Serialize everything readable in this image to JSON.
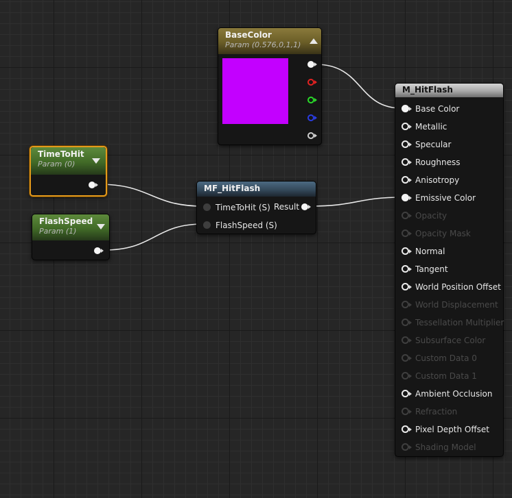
{
  "colors": {
    "swatch": "#c300ff",
    "selection_outline": "#e59a1b",
    "wire": "#e8e8e8"
  },
  "base_color_node": {
    "title": "BaseColor",
    "subtitle": "Param (0.576,0,1,1)"
  },
  "time_to_hit_node": {
    "title": "TimeToHit",
    "subtitle": "Param (0)"
  },
  "flash_speed_node": {
    "title": "FlashSpeed",
    "subtitle": "Param (1)"
  },
  "mf_node": {
    "title": "MF_HitFlash",
    "inputs": [
      "TimeToHit (S)",
      "FlashSpeed (S)"
    ],
    "output": "Result"
  },
  "material_node": {
    "title": "M_HitFlash",
    "inputs": [
      {
        "label": "Base Color",
        "enabled": true,
        "connected": true
      },
      {
        "label": "Metallic",
        "enabled": true,
        "connected": false
      },
      {
        "label": "Specular",
        "enabled": true,
        "connected": false
      },
      {
        "label": "Roughness",
        "enabled": true,
        "connected": false
      },
      {
        "label": "Anisotropy",
        "enabled": true,
        "connected": false
      },
      {
        "label": "Emissive Color",
        "enabled": true,
        "connected": true
      },
      {
        "label": "Opacity",
        "enabled": false,
        "connected": false
      },
      {
        "label": "Opacity Mask",
        "enabled": false,
        "connected": false
      },
      {
        "label": "Normal",
        "enabled": true,
        "connected": false
      },
      {
        "label": "Tangent",
        "enabled": true,
        "connected": false
      },
      {
        "label": "World Position Offset",
        "enabled": true,
        "connected": false
      },
      {
        "label": "World Displacement",
        "enabled": false,
        "connected": false
      },
      {
        "label": "Tessellation Multiplier",
        "enabled": false,
        "connected": false
      },
      {
        "label": "Subsurface Color",
        "enabled": false,
        "connected": false
      },
      {
        "label": "Custom Data 0",
        "enabled": false,
        "connected": false
      },
      {
        "label": "Custom Data 1",
        "enabled": false,
        "connected": false
      },
      {
        "label": "Ambient Occlusion",
        "enabled": true,
        "connected": false
      },
      {
        "label": "Refraction",
        "enabled": false,
        "connected": false
      },
      {
        "label": "Pixel Depth Offset",
        "enabled": true,
        "connected": false
      },
      {
        "label": "Shading Model",
        "enabled": false,
        "connected": false
      }
    ]
  }
}
